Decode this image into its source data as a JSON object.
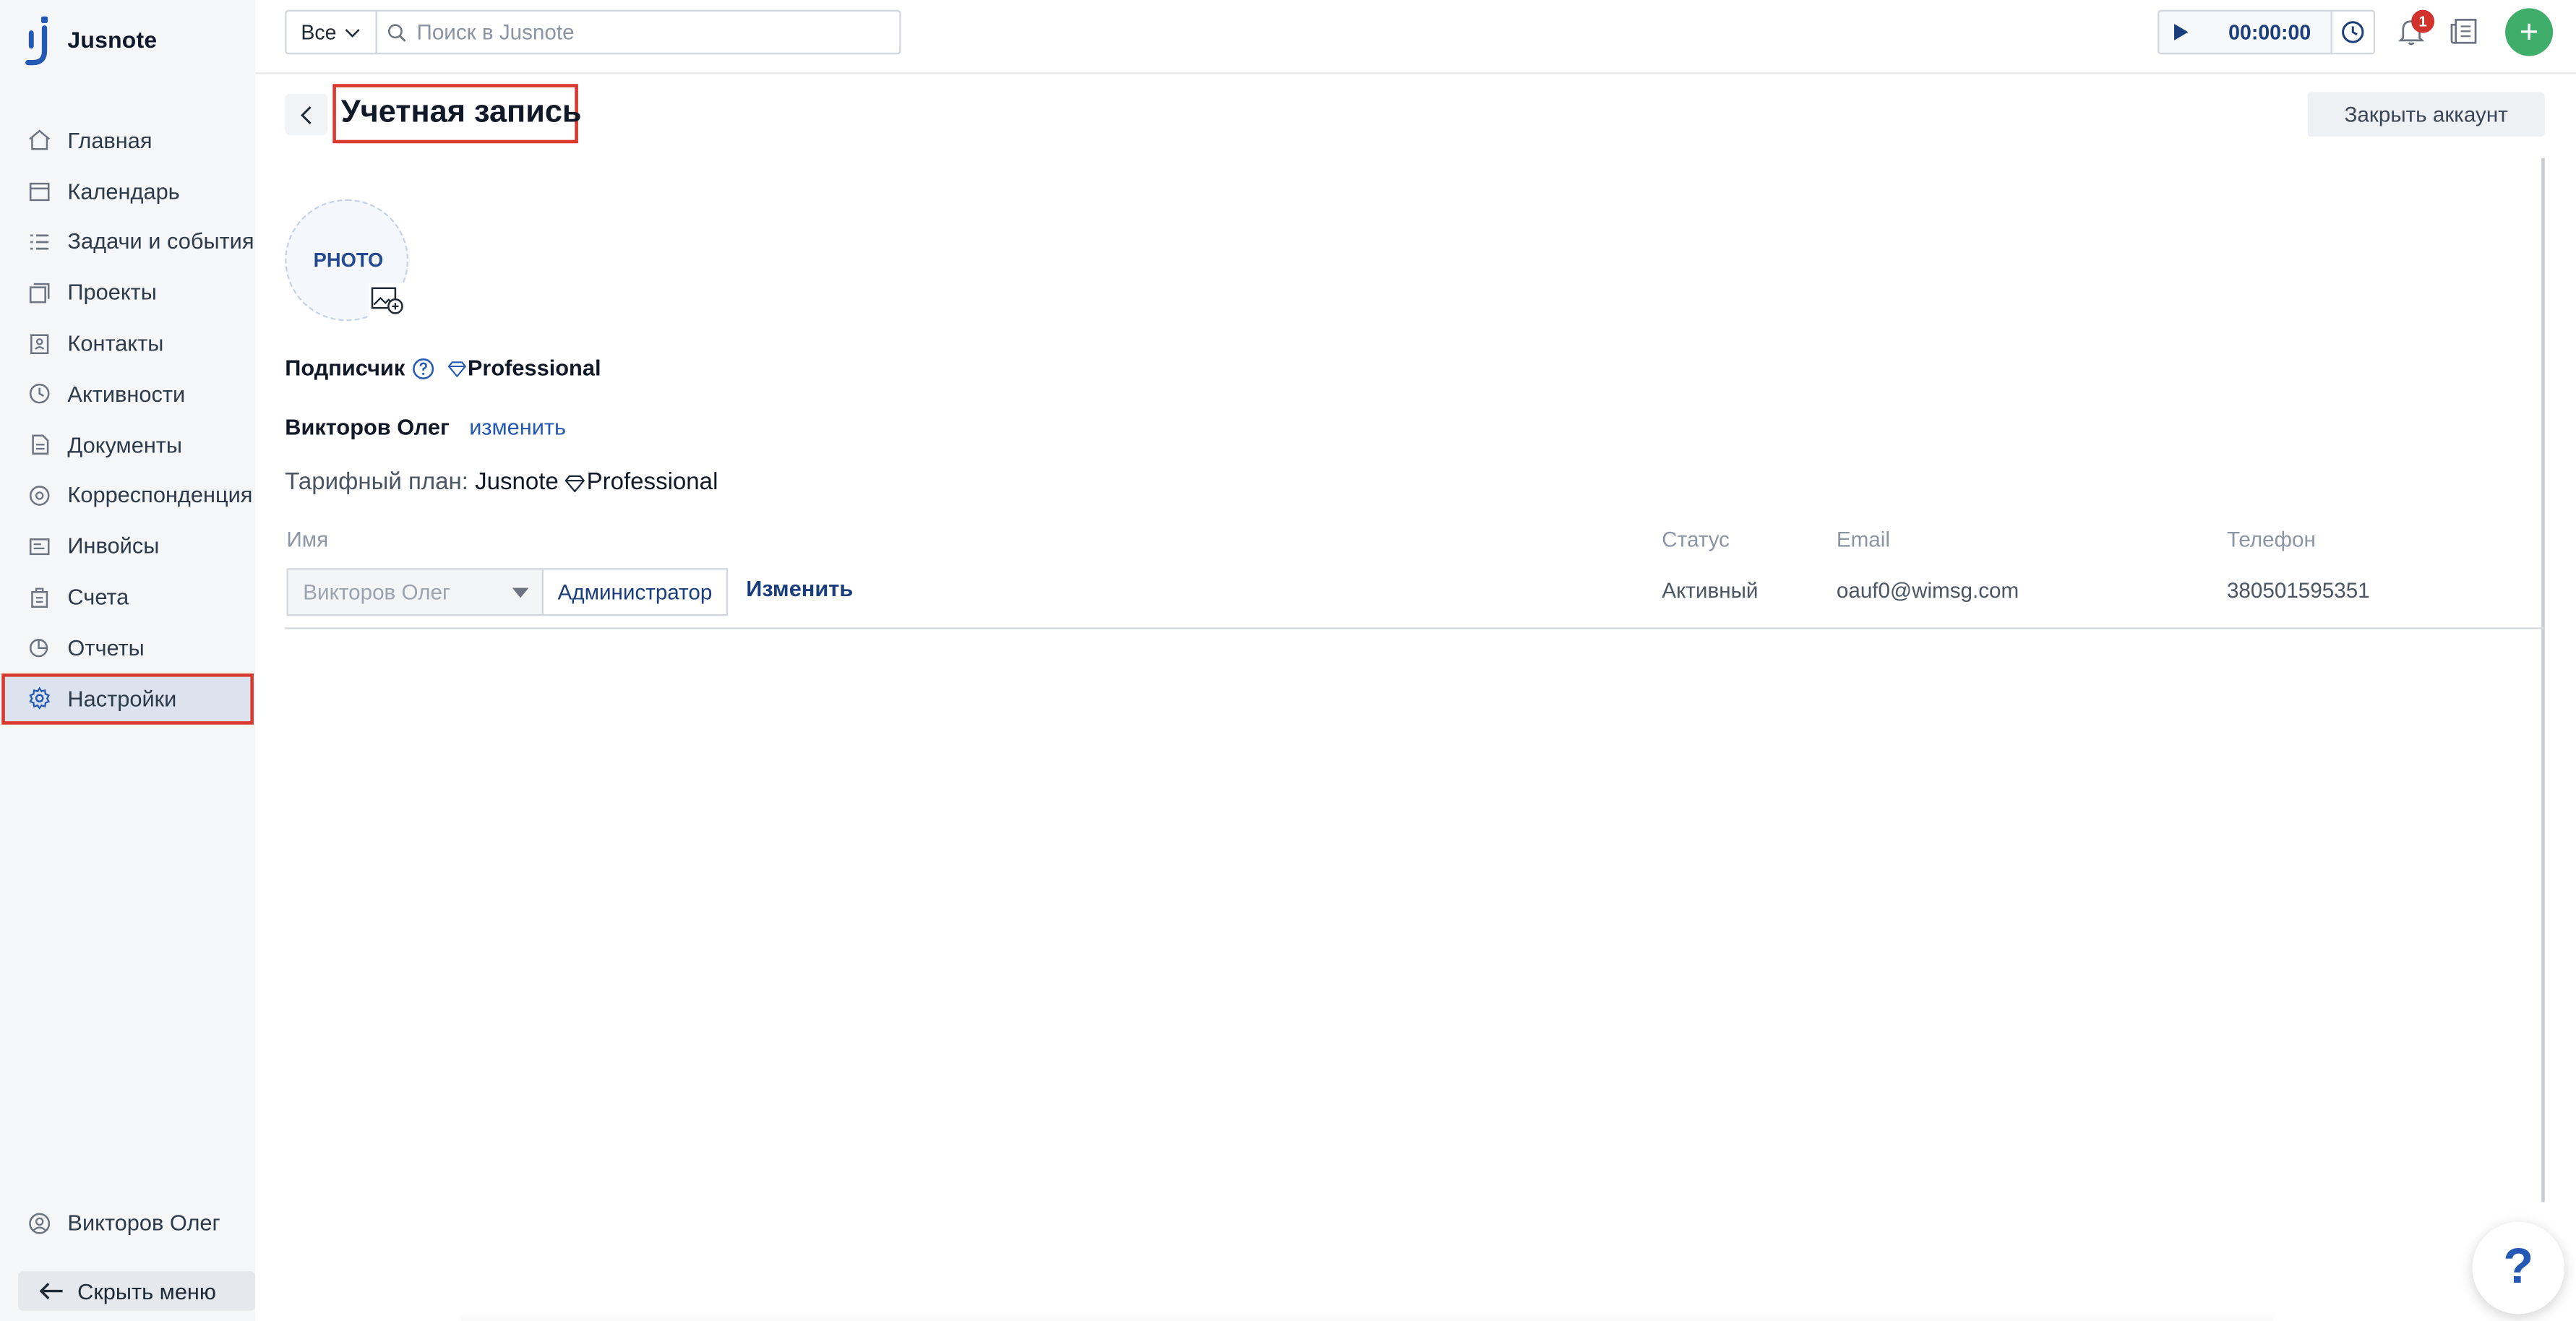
{
  "app": {
    "name": "Jusnote"
  },
  "sidebar": {
    "items": [
      {
        "label": "Главная",
        "icon": "home-icon"
      },
      {
        "label": "Календарь",
        "icon": "calendar-icon"
      },
      {
        "label": "Задачи и события",
        "icon": "tasks-icon"
      },
      {
        "label": "Проекты",
        "icon": "projects-icon"
      },
      {
        "label": "Контакты",
        "icon": "contacts-icon"
      },
      {
        "label": "Активности",
        "icon": "activity-icon"
      },
      {
        "label": "Документы",
        "icon": "documents-icon"
      },
      {
        "label": "Корреспонденция",
        "icon": "correspondence-icon"
      },
      {
        "label": "Инвойсы",
        "icon": "invoices-icon"
      },
      {
        "label": "Счета",
        "icon": "bills-icon"
      },
      {
        "label": "Отчеты",
        "icon": "reports-icon"
      },
      {
        "label": "Настройки",
        "icon": "gear-icon",
        "active": true
      }
    ],
    "user_name": "Викторов Олег",
    "hide_menu_label": "Скрыть меню"
  },
  "topbar": {
    "scope_value": "Все",
    "search_placeholder": "Поиск в Jusnote",
    "timer_value": "00:00:00",
    "notifications_count": "1"
  },
  "page": {
    "title": "Учетная запись",
    "close_account_label": "Закрыть аккаунт",
    "photo_label": "PHOTO",
    "subscriber_label": "Подписчик",
    "subscriber_plan": "Professional",
    "owner_name": "Викторов Олег",
    "owner_edit_label": "изменить",
    "tariff_prefix": "Тарифный план:",
    "tariff_product": "Jusnote",
    "tariff_plan": "Professional"
  },
  "users_table": {
    "headers": {
      "name": "Имя",
      "status": "Статус",
      "email": "Email",
      "phone": "Телефон"
    },
    "rows": [
      {
        "name": "Викторов Олег",
        "role": "Администратор",
        "action": "Изменить",
        "status": "Активный",
        "email": "oauf0@wimsg.com",
        "phone": "380501595351"
      }
    ]
  },
  "help_fab_label": "?",
  "colors": {
    "accent": "#2358b4",
    "highlight_border": "#d73a2c",
    "add_button": "#3fae6a",
    "badge": "#d1332c"
  }
}
